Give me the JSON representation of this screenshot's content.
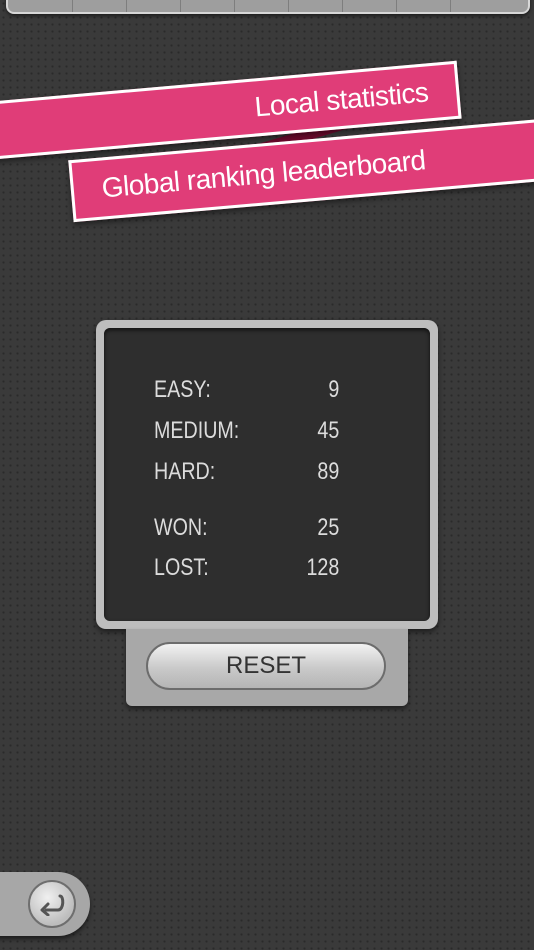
{
  "ribbons": {
    "local_label": "Local statistics",
    "global_label": "Global ranking leaderboard"
  },
  "stats": {
    "rows": [
      {
        "label": "EASY:",
        "value": "9"
      },
      {
        "label": "MEDIUM:",
        "value": "45"
      },
      {
        "label": "HARD:",
        "value": "89"
      },
      {
        "label": "WON:",
        "value": "25"
      },
      {
        "label": "LOST:",
        "value": "128"
      }
    ]
  },
  "reset_label": "RESET",
  "icons": {
    "back": "back-arrow-icon"
  },
  "colors": {
    "ribbon": "#e03d78",
    "ribbon_fold": "#6e0a2e",
    "panel_frame": "#bdbdbd",
    "panel_inner": "#2e2e2e",
    "background": "#3a3a3a"
  }
}
